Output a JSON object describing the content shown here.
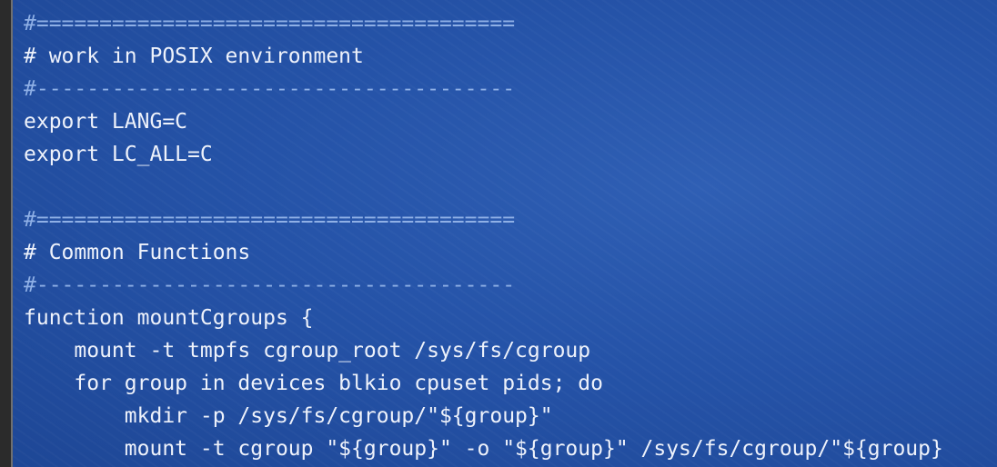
{
  "editor": {
    "lines": [
      {
        "text": "#======================================",
        "kind": "comment-rule"
      },
      {
        "text": "# work in POSIX environment",
        "kind": "comment"
      },
      {
        "text": "#--------------------------------------",
        "kind": "comment-rule"
      },
      {
        "text": "export LANG=C",
        "kind": "code"
      },
      {
        "text": "export LC_ALL=C",
        "kind": "code"
      },
      {
        "text": "",
        "kind": "blank"
      },
      {
        "text": "#======================================",
        "kind": "comment-rule"
      },
      {
        "text": "# Common Functions",
        "kind": "comment"
      },
      {
        "text": "#--------------------------------------",
        "kind": "comment-rule"
      },
      {
        "text": "function mountCgroups {",
        "kind": "code"
      },
      {
        "text": "    mount -t tmpfs cgroup_root /sys/fs/cgroup",
        "kind": "code"
      },
      {
        "text": "    for group in devices blkio cpuset pids; do",
        "kind": "code"
      },
      {
        "text": "        mkdir -p /sys/fs/cgroup/\"${group}\"",
        "kind": "code"
      },
      {
        "text": "        mount -t cgroup \"${group}\" -o \"${group}\" /sys/fs/cgroup/\"${group}",
        "kind": "code"
      }
    ]
  },
  "colors": {
    "background": "#2553a8",
    "text": "#eef2fb",
    "comment_rule": "#8fb0e6",
    "gutter": "#2b2b2b"
  }
}
